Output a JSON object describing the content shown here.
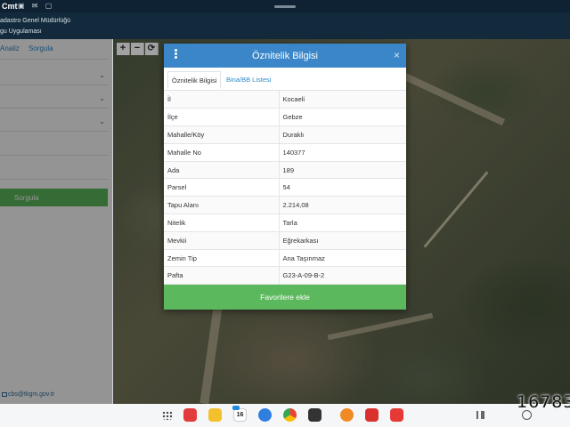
{
  "status_bar": {
    "time": "Cmt",
    "icons": [
      "screenshot-icon",
      "notification-icon",
      "gallery-icon"
    ]
  },
  "header": {
    "line1": "adastro Genel Müdürlüğü",
    "line2": "gu Uygulaması"
  },
  "left_panel": {
    "tabs": [
      "Analiz",
      "Sorgula"
    ],
    "search_button": "Sorgula",
    "email": "cbs@tkgm.gov.tr"
  },
  "map_controls": [
    "+",
    "−",
    "⟳"
  ],
  "dialog": {
    "title": "Öznitelik Bilgisi",
    "close": "×",
    "tabs": [
      "Öznitelik Bilgisi",
      "Bina/BB Listesi"
    ],
    "active_tab": "Öznitelik Bilgisi",
    "rows": [
      {
        "key": "İl",
        "value": "Kocaeli"
      },
      {
        "key": "İlçe",
        "value": "Gebze"
      },
      {
        "key": "Mahalle/Köy",
        "value": "Duraklı"
      },
      {
        "key": "Mahalle No",
        "value": "140377"
      },
      {
        "key": "Ada",
        "value": "189"
      },
      {
        "key": "Parsel",
        "value": "54"
      },
      {
        "key": "Tapu Alanı",
        "value": "2.214,08"
      },
      {
        "key": "Nitelik",
        "value": "Tarla"
      },
      {
        "key": "Mevkii",
        "value": "Eğrekarkası"
      },
      {
        "key": "Zemin Tip",
        "value": "Ana Taşınmaz"
      },
      {
        "key": "Pafta",
        "value": "G23-A-09-B-2"
      }
    ],
    "favorite_button": "Favorilere ekle"
  },
  "taskbar": {
    "apps": [
      "apps-grid-icon",
      "notes-app-icon",
      "files-app-icon",
      "calendar-app-icon",
      "messages-app-icon",
      "chrome-app-icon",
      "camera-app-icon",
      "app-orange-icon",
      "app-red-home-icon",
      "app-red-icon"
    ],
    "calendar_day": "16"
  },
  "overlay_number": "16783",
  "colors": {
    "header": "#3a86c8",
    "success": "#5cb85c",
    "link": "#2f8bc9"
  }
}
